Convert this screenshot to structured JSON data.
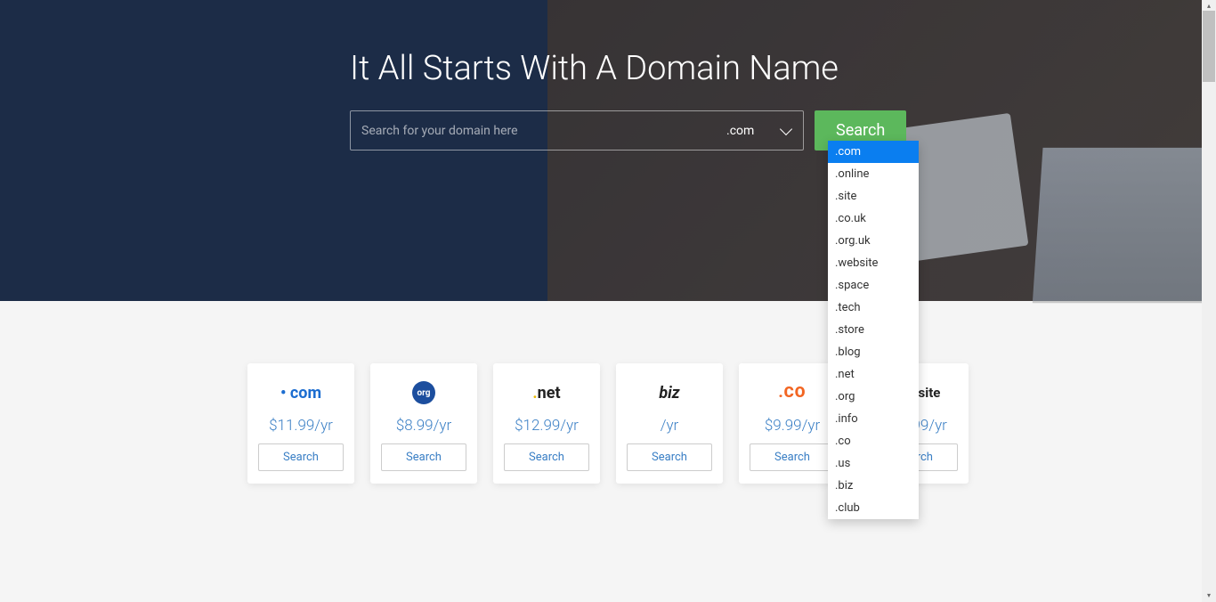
{
  "hero": {
    "title": "It All Starts With A Domain Name",
    "search_placeholder": "Search for your domain here",
    "selected_tld": ".com",
    "search_button": "Search"
  },
  "tld_options": [
    ".com",
    ".online",
    ".site",
    ".co.uk",
    ".org.uk",
    ".website",
    ".space",
    ".tech",
    ".store",
    ".blog",
    ".net",
    ".org",
    ".info",
    ".co",
    ".us",
    ".biz",
    ".club"
  ],
  "tld_cards": [
    {
      "name": "com",
      "price": "$11.99/yr",
      "btn": "Search"
    },
    {
      "name": "org",
      "price": "$8.99/yr",
      "btn": "Search"
    },
    {
      "name": "net",
      "price": "$12.99/yr",
      "btn": "Search"
    },
    {
      "name": "biz",
      "price": "/yr",
      "btn": "Search"
    },
    {
      "name": "CO",
      "price": "$9.99/yr",
      "btn": "Search"
    },
    {
      "name": "website",
      "price": "$11.99/yr",
      "btn": "Search"
    }
  ]
}
